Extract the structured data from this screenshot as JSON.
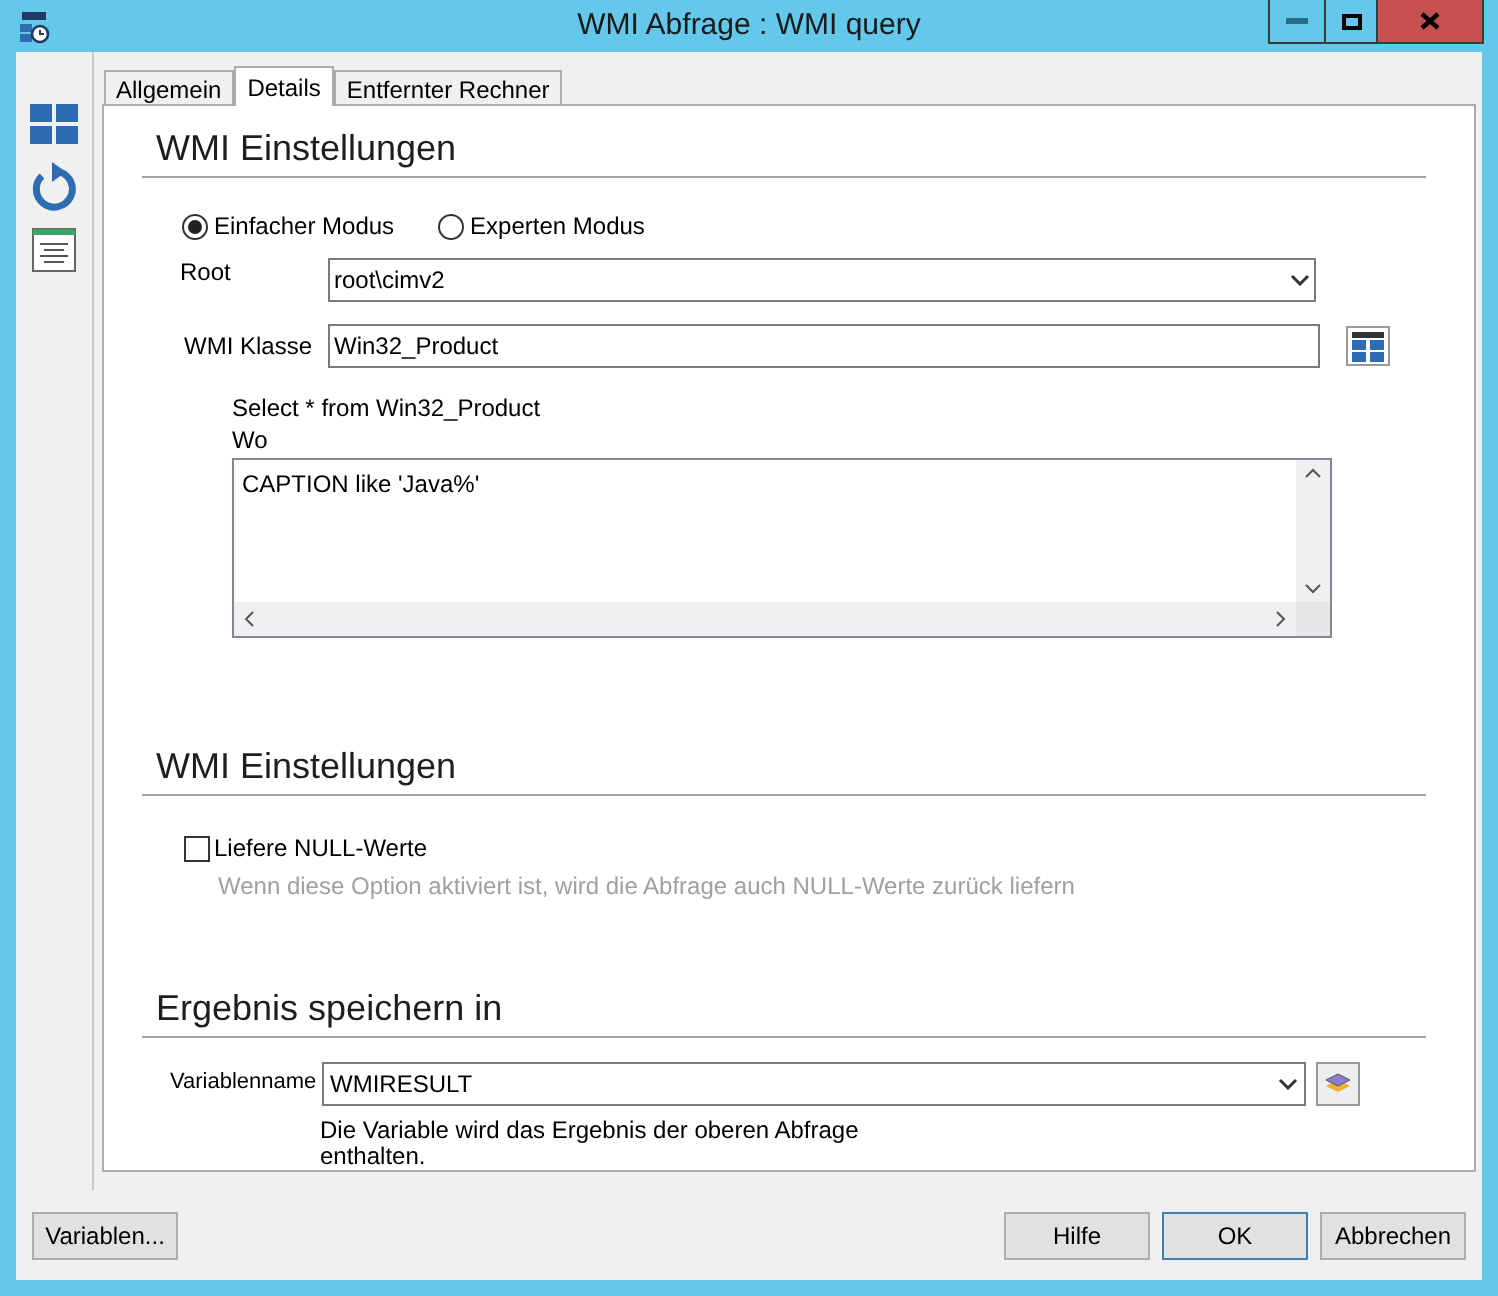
{
  "window": {
    "title": "WMI Abfrage : WMI query"
  },
  "tabs": [
    {
      "label": "Allgemein",
      "selected": false
    },
    {
      "label": "Details",
      "selected": true
    },
    {
      "label": "Entfernter Rechner",
      "selected": false
    }
  ],
  "sections": [
    {
      "title": "WMI Einstellungen"
    },
    {
      "title": "WMI Einstellungen"
    },
    {
      "title": "Ergebnis speichern in"
    }
  ],
  "modes": [
    {
      "label": "Einfacher Modus",
      "selected": true
    },
    {
      "label": "Experten Modus",
      "selected": false
    }
  ],
  "root": {
    "label": "Root",
    "value": "root\\cimv2"
  },
  "wmi_class": {
    "label": "WMI Klasse",
    "value": "Win32_Product"
  },
  "query": {
    "select": "Select * from Win32_Product",
    "where_label": "Wo",
    "where": "CAPTION like 'Java%'"
  },
  "null_values": {
    "label": "Liefere NULL-Werte",
    "checked": false,
    "hint": "Wenn diese Option aktiviert ist, wird die Abfrage auch NULL-Werte zurück liefern"
  },
  "result": {
    "label": "Variablenname",
    "value": "WMIRESULT",
    "hint_lines": [
      "Die Variable wird das Ergebnis der oberen Abfrage",
      "enthalten."
    ]
  },
  "buttons": [
    {
      "label": "Variablen..."
    },
    {
      "label": "Hilfe"
    },
    {
      "label": "OK"
    },
    {
      "label": "Abbrechen"
    }
  ]
}
